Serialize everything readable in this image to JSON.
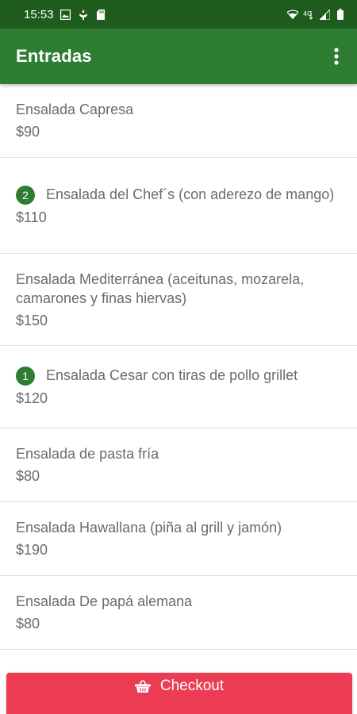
{
  "status_bar": {
    "time": "15:53",
    "left_icons": [
      "image-icon",
      "app-icon",
      "sd-card-icon"
    ],
    "right_icons": [
      "wifi-icon",
      "data-icon",
      "signal-icon",
      "battery-icon"
    ],
    "data_label": "4G"
  },
  "app_bar": {
    "title": "Entradas",
    "menu_icon": "more-vert-icon"
  },
  "items": [
    {
      "name": "Ensalada Capresa",
      "price": "$90",
      "qty": ""
    },
    {
      "name": "Ensalada del Chef´s (con aderezo de mango)",
      "price": "$110",
      "qty": "2"
    },
    {
      "name": "Ensalada Mediterránea (aceitunas, mozarela, camarones y finas hiervas)",
      "price": "$150",
      "qty": ""
    },
    {
      "name": "Ensalada Cesar con tiras de pollo grillet",
      "price": "$120",
      "qty": "1"
    },
    {
      "name": "Ensalada de pasta fría",
      "price": "$80",
      "qty": ""
    },
    {
      "name": "Ensalada Hawallana (piña al grill y jamón)",
      "price": "$190",
      "qty": ""
    },
    {
      "name": "Ensalada De papá alemana",
      "price": "$80",
      "qty": ""
    }
  ],
  "checkout": {
    "label": "Checkout",
    "icon": "basket-icon"
  },
  "colors": {
    "status_bar": "#1e5c1e",
    "app_bar": "#2e7d32",
    "badge": "#2e7d32",
    "checkout": "#ec3c54",
    "text": "#6b6b6b"
  }
}
